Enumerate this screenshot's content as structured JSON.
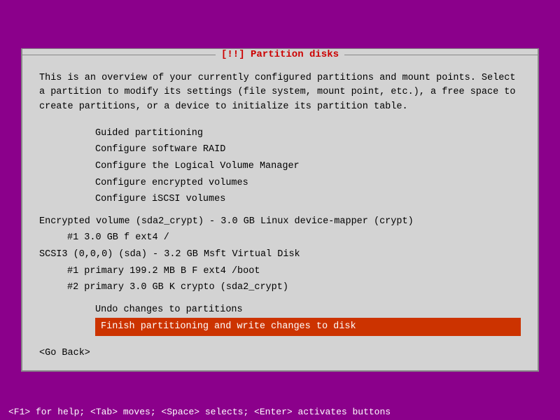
{
  "title": "[!!] Partition disks",
  "description": "This is an overview of your currently configured partitions and mount points. Select a partition to modify its settings (file system, mount point, etc.), a free space to create partitions, or a device to initialize its partition table.",
  "menu_items": [
    "Guided partitioning",
    "Configure software RAID",
    "Configure the Logical Volume Manager",
    "Configure encrypted volumes",
    "Configure iSCSI volumes"
  ],
  "partitions": {
    "encrypted_header": "Encrypted volume (sda2_crypt) - 3.0 GB Linux device-mapper (crypt)",
    "encrypted_entry": "#1          3.0 GB     f  ext4        /",
    "scsi_header": "SCSI3 (0,0,0) (sda) - 3.2 GB Msft Virtual Disk",
    "scsi_entry1": "#1  primary   199.2 MB  B  F  ext4      /boot",
    "scsi_entry2": "#2  primary     3.0 GB     K  crypto    (sda2_crypt)"
  },
  "actions": {
    "undo": "Undo changes to partitions",
    "finish": "Finish partitioning and write changes to disk"
  },
  "go_back": "<Go Back>",
  "status_bar": "<F1> for help; <Tab> moves; <Space> selects; <Enter> activates buttons"
}
